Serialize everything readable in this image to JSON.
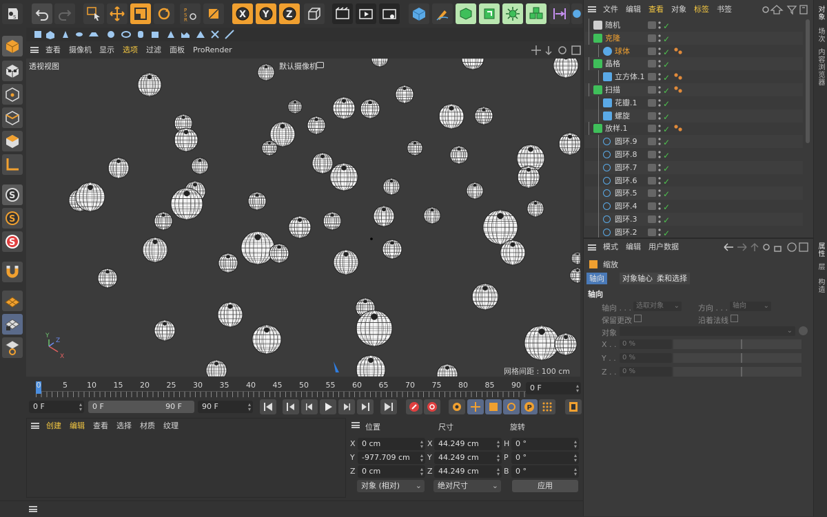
{
  "colors": {
    "accent_orange": "#f0a030",
    "active_menu": "#f5c842",
    "check_green": "#4ec24e",
    "viewport_bg": "#3b3b3b"
  },
  "toolbar": {
    "icons": [
      "undo-icon",
      "redo-icon",
      "select-arrow-icon",
      "move-icon",
      "scale-icon",
      "rotate-icon",
      "psr-icon",
      "coordinate-icon",
      "x-axis-icon",
      "y-axis-icon",
      "z-axis-icon",
      "coordinate-system-icon",
      "render-region-icon",
      "render-view-icon",
      "render-settings-icon",
      "cube-icon",
      "pen-icon",
      "subdivision-icon",
      "cloner-icon",
      "mograph-icon",
      "volume-icon",
      "deformer-icon",
      "environment-icon"
    ],
    "psr_label": "PSR",
    "x": "X",
    "y": "Y",
    "z": "Z"
  },
  "viewport": {
    "menu": [
      "查看",
      "摄像机",
      "显示",
      "选项",
      "过滤",
      "面板",
      "ProRender"
    ],
    "active_menu_index": 3,
    "view_name": "透视视图",
    "camera_name": "默认摄像机",
    "grid_spacing": "网格间距 : 100 cm",
    "axis_x": "X",
    "axis_y": "Y",
    "axis_z": "Z"
  },
  "timeline": {
    "ticks": [
      "0",
      "5",
      "10",
      "15",
      "20",
      "25",
      "30",
      "35",
      "40",
      "45",
      "50",
      "55",
      "60",
      "65",
      "70",
      "75",
      "80",
      "85",
      "90"
    ],
    "current_frame": "0 F",
    "start_field": "0 F",
    "range_start": "0 F",
    "range_end": "90 F",
    "end_field": "90 F"
  },
  "material_manager": {
    "menu": [
      "创建",
      "编辑",
      "查看",
      "选择",
      "材质",
      "纹理"
    ]
  },
  "coordinates": {
    "headers": [
      "位置",
      "尺寸",
      "旋转"
    ],
    "rows": [
      {
        "axis": "X",
        "pos": "0 cm",
        "size_axis": "X",
        "size": "44.249 cm",
        "rot_axis": "H",
        "rot": "0 °"
      },
      {
        "axis": "Y",
        "pos": "-977.709 cm",
        "size_axis": "Y",
        "size": "44.249 cm",
        "rot_axis": "P",
        "rot": "0 °"
      },
      {
        "axis": "Z",
        "pos": "0 cm",
        "size_axis": "Z",
        "size": "44.249 cm",
        "rot_axis": "B",
        "rot": "0 °"
      }
    ],
    "mode_select": "对象 (相对)",
    "size_select": "绝对尺寸",
    "apply": "应用"
  },
  "object_manager": {
    "menu": [
      "文件",
      "编辑",
      "查看",
      "对象",
      "标签",
      "书签"
    ],
    "active_menu_indices": [
      2,
      4
    ],
    "objects": [
      {
        "name": "随机",
        "icon": "random-effector-icon",
        "depth": 0,
        "tag": false,
        "highlight": false
      },
      {
        "name": "克隆",
        "icon": "cloner-icon",
        "depth": 0,
        "tag": false,
        "highlight": true
      },
      {
        "name": "球体",
        "icon": "sphere-icon",
        "depth": 1,
        "tag": true,
        "highlight": true
      },
      {
        "name": "晶格",
        "icon": "atom-array-icon",
        "depth": 0,
        "tag": false,
        "highlight": false
      },
      {
        "name": "立方体.1",
        "icon": "cube-icon",
        "depth": 1,
        "tag": true,
        "highlight": false
      },
      {
        "name": "扫描",
        "icon": "sweep-icon",
        "depth": 0,
        "tag": true,
        "highlight": false
      },
      {
        "name": "花瓣.1",
        "icon": "spline-icon",
        "depth": 1,
        "tag": false,
        "highlight": false
      },
      {
        "name": "螺旋",
        "icon": "helix-icon",
        "depth": 1,
        "tag": false,
        "highlight": false
      },
      {
        "name": "放样.1",
        "icon": "loft-icon",
        "depth": 0,
        "tag": true,
        "highlight": false
      },
      {
        "name": "圆环.9",
        "icon": "circle-icon",
        "depth": 1,
        "tag": false,
        "highlight": false
      },
      {
        "name": "圆环.8",
        "icon": "circle-icon",
        "depth": 1,
        "tag": false,
        "highlight": false
      },
      {
        "name": "圆环.7",
        "icon": "circle-icon",
        "depth": 1,
        "tag": false,
        "highlight": false
      },
      {
        "name": "圆环.6",
        "icon": "circle-icon",
        "depth": 1,
        "tag": false,
        "highlight": false
      },
      {
        "name": "圆环.5",
        "icon": "circle-icon",
        "depth": 1,
        "tag": false,
        "highlight": false
      },
      {
        "name": "圆环.4",
        "icon": "circle-icon",
        "depth": 1,
        "tag": false,
        "highlight": false
      },
      {
        "name": "圆环.3",
        "icon": "circle-icon",
        "depth": 1,
        "tag": false,
        "highlight": false
      },
      {
        "name": "圆环.2",
        "icon": "circle-icon",
        "depth": 1,
        "tag": false,
        "highlight": false
      }
    ]
  },
  "attributes": {
    "menu": [
      "模式",
      "编辑",
      "用户数据"
    ],
    "object_title": "缩放",
    "tabs": [
      "轴向",
      "对象轴心",
      "柔和选择"
    ],
    "section": "轴向",
    "axis_label": "轴向 . . .",
    "axis_value": "选取对象",
    "direction_label": "方向 . . .",
    "direction_value": "轴向",
    "keep_changes": "保留更改",
    "along_normal": "沿着法线",
    "object_label": "对象",
    "x_label": "X . .",
    "y_label": "Y . .",
    "z_label": "Z . .",
    "x_value": "0 %",
    "y_value": "0 %",
    "z_value": "0 %"
  },
  "side_tabs_top": [
    "对象",
    "场次",
    "内容浏览器"
  ],
  "side_tabs_bottom": [
    "属性",
    "层",
    "构造"
  ]
}
